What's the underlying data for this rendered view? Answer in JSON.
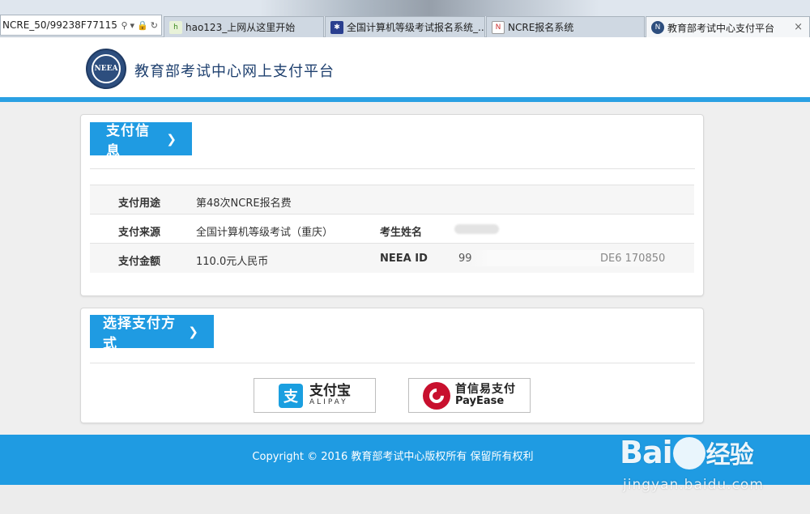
{
  "browser": {
    "address": "NCRE_50/99238F77115",
    "tabs": [
      {
        "label": "hao123_上网从这里开始",
        "favicon": "hao123-favicon"
      },
      {
        "label": "全国计算机等级考试报名系统_...",
        "favicon": "paw-favicon"
      },
      {
        "label": "NCRE报名系统",
        "favicon": "ncre-favicon"
      },
      {
        "label": "教育部考试中心支付平台",
        "favicon": "neea-favicon",
        "active": true
      }
    ],
    "close_glyph": "×"
  },
  "header": {
    "logo_text": "NEEA",
    "title": "教育部考试中心网上支付平台"
  },
  "payment_info": {
    "heading": "支付信息",
    "rows": [
      {
        "label": "支付用途",
        "value": "第48次NCRE报名费"
      },
      {
        "label": "支付来源",
        "value": "全国计算机等级考试（重庆）",
        "label2": "考生姓名",
        "value2": ""
      },
      {
        "label": "支付金额",
        "value": "110.0元人民币",
        "label2": "NEEA ID",
        "value2": "99",
        "value2_tail": "DE6  170850"
      }
    ]
  },
  "payment_method": {
    "heading": "选择支付方式",
    "options": [
      {
        "name": "支付宝",
        "sub": "ALIPAY",
        "mark": "支"
      },
      {
        "name": "首信易支付",
        "sub": "PayEase"
      }
    ]
  },
  "footer": {
    "copyright": "Copyright © 2016 教育部考试中心版权所有 保留所有权利"
  },
  "watermark": {
    "brand_left": "Bai",
    "brand_right": "经验",
    "url": "jingyan.baidu.com"
  },
  "colors": {
    "accent": "#1f9be2",
    "brand_dark": "#1d3f6e",
    "alipay": "#1a9fe0",
    "payease": "#c8102e"
  }
}
